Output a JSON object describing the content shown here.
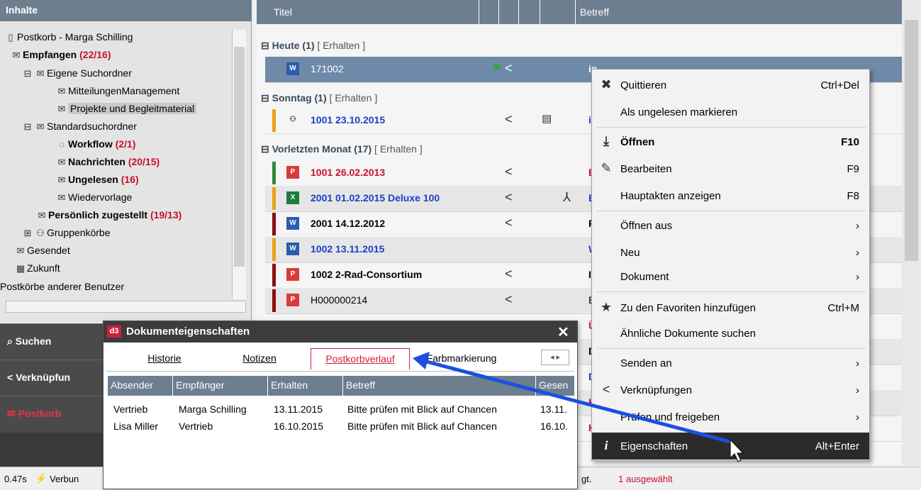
{
  "left_panel": {
    "header": "Inhalte",
    "tree": {
      "postkorb": "Postkorb - Marga Schilling",
      "empfangen": "Empfangen",
      "empfangen_count": "(22/16)",
      "eigene": "Eigene Suchordner",
      "mitteilungen": "MitteilungenManagement",
      "projekte": "Projekte und Begleitmaterial",
      "standard": "Standardsuchordner",
      "workflow": "Workflow",
      "workflow_count": "(2/1)",
      "nachrichten": "Nachrichten",
      "nachrichten_count": "(20/15)",
      "ungelesen": "Ungelesen",
      "ungelesen_count": "(16)",
      "wiedervorlage": "Wiedervorlage",
      "persoenlich": "Persönlich zugestellt",
      "persoenlich_count": "(19/13)",
      "gruppen": "Gruppenkörbe",
      "gesendet": "Gesendet",
      "zukunft": "Zukunft",
      "andere": "Postkörbe anderer Benutzer"
    },
    "nav": {
      "suchen": "Suchen",
      "verknuepfungen": "Verknüpfun",
      "postkorb": "Postkorb"
    }
  },
  "status": {
    "time": "0.47s",
    "connection": "Verbun",
    "gt": "gt.",
    "selected": "1 ausgewählt"
  },
  "list": {
    "col_title": "Titel",
    "col_subject": "Betreff",
    "groups": {
      "heute": "Heute (1)",
      "sonntag": "Sonntag (1)",
      "vorletzten": "Vorletzten Monat (17)",
      "erhalten": "[ Erhalten ]"
    },
    "rows": [
      {
        "title": "171002",
        "subject": "in"
      },
      {
        "title": "1001   23.10.2015",
        "subject": "in"
      },
      {
        "title": "1001   26.02.2013",
        "subject": "B"
      },
      {
        "title": "2001   01.02.2015 Deluxe 100",
        "subject": "B"
      },
      {
        "title": "2001   14.12.2012",
        "subject": "P"
      },
      {
        "title": "1002   13.11.2015",
        "subject": "W"
      },
      {
        "title": "1002  2-Rad-Consortium",
        "subject": "In"
      },
      {
        "title": "H000000214",
        "subject": "E"
      },
      {
        "title": "",
        "subject": "Ü"
      },
      {
        "title": "",
        "subject": "D"
      },
      {
        "title": "",
        "subject": "D"
      },
      {
        "title": "",
        "subject": "K"
      },
      {
        "title": "",
        "subject": "K"
      }
    ],
    "colors": {
      "green": "#2e8b3a",
      "orange": "#e8a317",
      "darkred": "#8b1010",
      "blue": "#1f3ec8",
      "red": "#c8102e"
    }
  },
  "context_menu": {
    "quittieren": "Quittieren",
    "quittieren_sc": "Ctrl+Del",
    "ungelesen": "Als ungelesen markieren",
    "oeffnen": "Öffnen",
    "oeffnen_sc": "F10",
    "bearbeiten": "Bearbeiten",
    "bearbeiten_sc": "F9",
    "hauptakten": "Hauptakten anzeigen",
    "hauptakten_sc": "F8",
    "oeffnen_aus": "Öffnen aus",
    "neu": "Neu",
    "dokument": "Dokument",
    "favoriten": "Zu den Favoriten hinzufügen",
    "favoriten_sc": "Ctrl+M",
    "aehnliche": "Ähnliche Dokumente suchen",
    "senden": "Senden an",
    "verknuepfungen": "Verknüpfungen",
    "pruefen": "Prüfen und freigeben",
    "eigenschaften": "Eigenschaften",
    "eigenschaften_sc": "Alt+Enter"
  },
  "dialog": {
    "logo": "d3",
    "title": "Dokumenteigenschaften",
    "tabs": [
      "Historie",
      "Notizen",
      "Postkorbverlauf",
      "Farbmarkierung"
    ],
    "columns": [
      "Absender",
      "Empfänger",
      "Erhalten",
      "Betreff",
      "Gesen"
    ],
    "rows": [
      [
        "Vertrieb",
        "Marga Schilling",
        "13.11.2015",
        "Bitte prüfen mit Blick auf Chancen",
        "13.11."
      ],
      [
        "Lisa Miller",
        "Vertrieb",
        "16.10.2015",
        "Bitte prüfen mit Blick auf Chancen",
        "16.10."
      ]
    ]
  }
}
